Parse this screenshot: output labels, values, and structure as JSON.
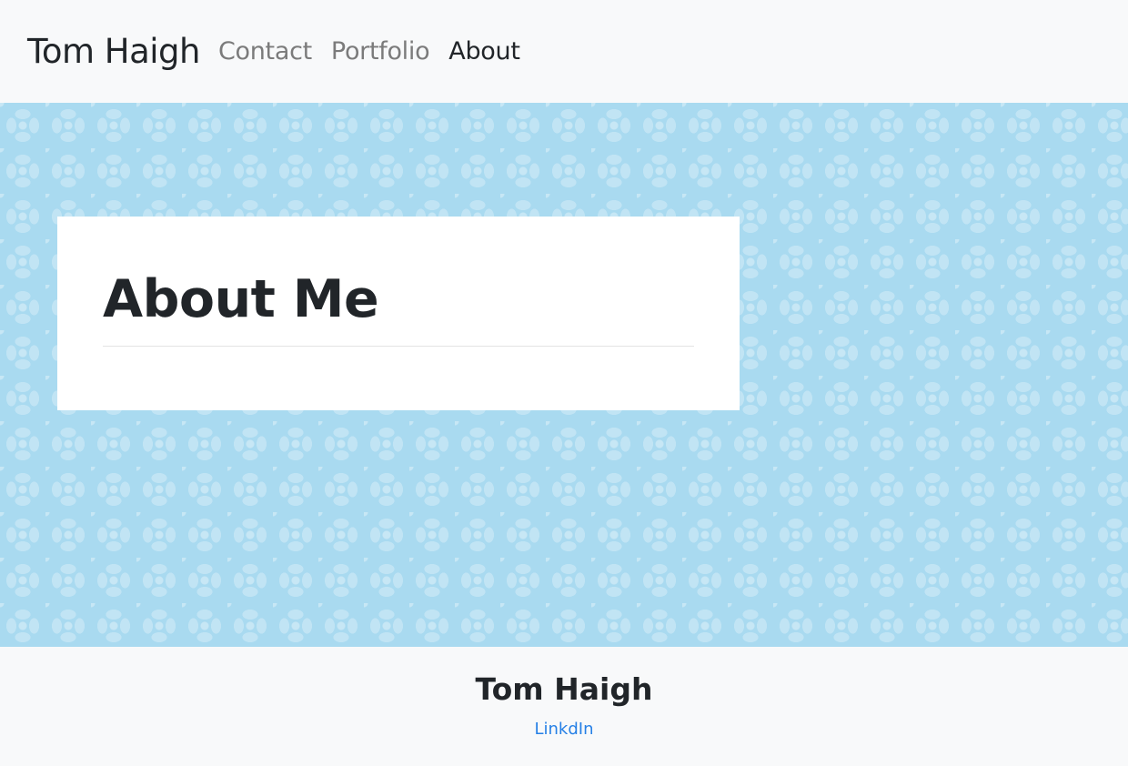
{
  "navbar": {
    "brand": "Tom Haigh",
    "links": [
      {
        "label": "Contact",
        "active": false
      },
      {
        "label": "Portfolio",
        "active": false
      },
      {
        "label": "About",
        "active": true
      }
    ]
  },
  "hero": {
    "background_color": "#a9daf0",
    "card": {
      "title": "About Me"
    }
  },
  "footer": {
    "name": "Tom Haigh",
    "link_label": "LinkdIn",
    "link_color": "#2680e6"
  }
}
